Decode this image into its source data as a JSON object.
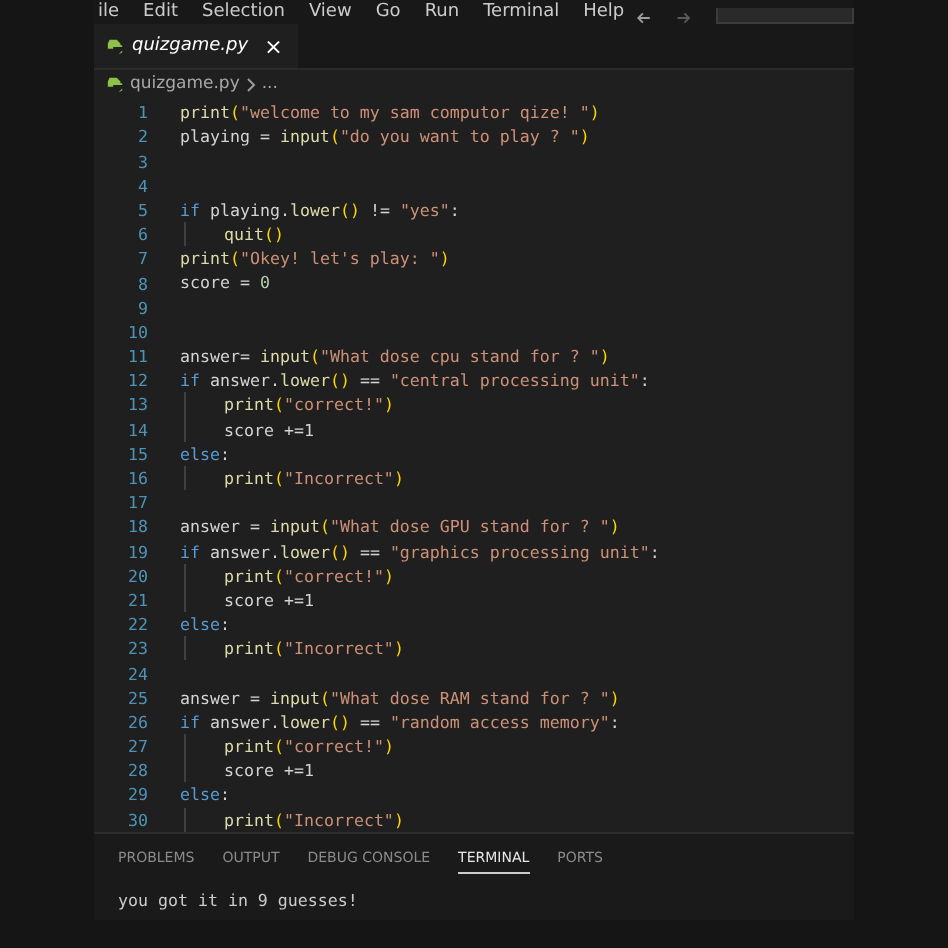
{
  "menu": [
    "ile",
    "Edit",
    "Selection",
    "View",
    "Go",
    "Run",
    "Terminal",
    "Help"
  ],
  "tab": {
    "label": "quizgame.py",
    "close": "×",
    "selected": true
  },
  "breadcrumb": {
    "file": "quizgame.py",
    "more": "..."
  },
  "code": [
    {
      "number": "1",
      "tokens": [
        {
          "kind": "func",
          "text": "print"
        },
        {
          "kind": "paren",
          "text": "("
        },
        {
          "kind": "string",
          "text": "\"welcome to my sam computor qize! \""
        },
        {
          "kind": "paren",
          "text": ")"
        }
      ]
    },
    {
      "number": "2",
      "tokens": [
        {
          "kind": "plain",
          "text": "playing = "
        },
        {
          "kind": "func",
          "text": "input"
        },
        {
          "kind": "paren",
          "text": "("
        },
        {
          "kind": "string",
          "text": "\"do you want to play ? \""
        },
        {
          "kind": "paren",
          "text": ")"
        }
      ]
    },
    {
      "number": "3"
    },
    {
      "number": "4"
    },
    {
      "number": "5",
      "tokens": [
        {
          "kind": "keyword",
          "text": "if"
        },
        {
          "kind": "plain",
          "text": " playing."
        },
        {
          "kind": "func",
          "text": "lower"
        },
        {
          "kind": "paren",
          "text": "()"
        },
        {
          "kind": "plain",
          "text": " != "
        },
        {
          "kind": "string",
          "text": "\"yes\""
        },
        {
          "kind": "plain",
          "text": ":"
        }
      ]
    },
    {
      "number": "6",
      "indented": true,
      "tokens": [
        {
          "kind": "func",
          "text": "quit"
        },
        {
          "kind": "paren",
          "text": "()"
        }
      ]
    },
    {
      "number": "7",
      "tokens": [
        {
          "kind": "func",
          "text": "print"
        },
        {
          "kind": "paren",
          "text": "("
        },
        {
          "kind": "string",
          "text": "\"Okey! let's play: \""
        },
        {
          "kind": "paren",
          "text": ")"
        }
      ]
    },
    {
      "number": "8",
      "tokens": [
        {
          "kind": "plain",
          "text": "score = "
        },
        {
          "kind": "number",
          "text": "0"
        }
      ]
    },
    {
      "number": "9"
    },
    {
      "number": "10"
    },
    {
      "number": "11",
      "tokens": [
        {
          "kind": "plain",
          "text": "answer= "
        },
        {
          "kind": "func",
          "text": "input"
        },
        {
          "kind": "paren",
          "text": "("
        },
        {
          "kind": "string",
          "text": "\"What dose cpu stand for ? \""
        },
        {
          "kind": "paren",
          "text": ")"
        }
      ]
    },
    {
      "number": "12",
      "tokens": [
        {
          "kind": "keyword",
          "text": "if"
        },
        {
          "kind": "plain",
          "text": " answer."
        },
        {
          "kind": "func",
          "text": "lower"
        },
        {
          "kind": "paren",
          "text": "()"
        },
        {
          "kind": "plain",
          "text": " == "
        },
        {
          "kind": "string",
          "text": "\"central processing unit\""
        },
        {
          "kind": "plain",
          "text": ":"
        }
      ]
    },
    {
      "number": "13",
      "indented": true,
      "tokens": [
        {
          "kind": "func",
          "text": "print"
        },
        {
          "kind": "paren",
          "text": "("
        },
        {
          "kind": "string",
          "text": "\"correct!\""
        },
        {
          "kind": "paren",
          "text": ")"
        }
      ]
    },
    {
      "number": "14",
      "indented": true,
      "tokens": [
        {
          "kind": "plain",
          "text": "score +=1"
        }
      ]
    },
    {
      "number": "15",
      "tokens": [
        {
          "kind": "keyword",
          "text": "else"
        },
        {
          "kind": "plain",
          "text": ":"
        }
      ]
    },
    {
      "number": "16",
      "indented": true,
      "tokens": [
        {
          "kind": "func",
          "text": "print"
        },
        {
          "kind": "paren",
          "text": "("
        },
        {
          "kind": "string",
          "text": "\"Incorrect\""
        },
        {
          "kind": "paren",
          "text": ")"
        }
      ]
    },
    {
      "number": "17"
    },
    {
      "number": "18",
      "tokens": [
        {
          "kind": "plain",
          "text": "answer = "
        },
        {
          "kind": "func",
          "text": "input"
        },
        {
          "kind": "paren",
          "text": "("
        },
        {
          "kind": "string",
          "text": "\"What dose GPU stand for ? \""
        },
        {
          "kind": "paren",
          "text": ")"
        }
      ]
    },
    {
      "number": "19",
      "tokens": [
        {
          "kind": "keyword",
          "text": "if"
        },
        {
          "kind": "plain",
          "text": " answer."
        },
        {
          "kind": "func",
          "text": "lower"
        },
        {
          "kind": "paren",
          "text": "()"
        },
        {
          "kind": "plain",
          "text": " == "
        },
        {
          "kind": "string",
          "text": "\"graphics processing unit\""
        },
        {
          "kind": "plain",
          "text": ":"
        }
      ]
    },
    {
      "number": "20",
      "indented": true,
      "tokens": [
        {
          "kind": "func",
          "text": "print"
        },
        {
          "kind": "paren",
          "text": "("
        },
        {
          "kind": "string",
          "text": "\"correct!\""
        },
        {
          "kind": "paren",
          "text": ")"
        }
      ]
    },
    {
      "number": "21",
      "indented": true,
      "tokens": [
        {
          "kind": "plain",
          "text": "score +=1"
        }
      ]
    },
    {
      "number": "22",
      "tokens": [
        {
          "kind": "keyword",
          "text": "else"
        },
        {
          "kind": "plain",
          "text": ":"
        }
      ]
    },
    {
      "number": "23",
      "indented": true,
      "tokens": [
        {
          "kind": "func",
          "text": "print"
        },
        {
          "kind": "paren",
          "text": "("
        },
        {
          "kind": "string",
          "text": "\"Incorrect\""
        },
        {
          "kind": "paren",
          "text": ")"
        }
      ]
    },
    {
      "number": "24"
    },
    {
      "number": "25",
      "tokens": [
        {
          "kind": "plain",
          "text": "answer = "
        },
        {
          "kind": "func",
          "text": "input"
        },
        {
          "kind": "paren",
          "text": "("
        },
        {
          "kind": "string",
          "text": "\"What dose RAM stand for ? \""
        },
        {
          "kind": "paren",
          "text": ")"
        }
      ]
    },
    {
      "number": "26",
      "tokens": [
        {
          "kind": "keyword",
          "text": "if"
        },
        {
          "kind": "plain",
          "text": " answer."
        },
        {
          "kind": "func",
          "text": "lower"
        },
        {
          "kind": "paren",
          "text": "()"
        },
        {
          "kind": "plain",
          "text": " == "
        },
        {
          "kind": "string",
          "text": "\"random access memory\""
        },
        {
          "kind": "plain",
          "text": ":"
        }
      ]
    },
    {
      "number": "27",
      "indented": true,
      "tokens": [
        {
          "kind": "func",
          "text": "print"
        },
        {
          "kind": "paren",
          "text": "("
        },
        {
          "kind": "string",
          "text": "\"correct!\""
        },
        {
          "kind": "paren",
          "text": ")"
        }
      ]
    },
    {
      "number": "28",
      "indented": true,
      "tokens": [
        {
          "kind": "plain",
          "text": "score +=1"
        }
      ]
    },
    {
      "number": "29",
      "tokens": [
        {
          "kind": "keyword",
          "text": "else"
        },
        {
          "kind": "plain",
          "text": ":"
        }
      ]
    },
    {
      "number": "30",
      "indented": true,
      "tokens": [
        {
          "kind": "func",
          "text": "print"
        },
        {
          "kind": "paren",
          "text": "("
        },
        {
          "kind": "string",
          "text": "\"Incorrect\""
        },
        {
          "kind": "paren",
          "text": ")"
        }
      ]
    }
  ],
  "panel_tabs": [
    {
      "label": "PROBLEMS",
      "selected": false
    },
    {
      "label": "OUTPUT",
      "selected": false
    },
    {
      "label": "DEBUG CONSOLE",
      "selected": false
    },
    {
      "label": "TERMINAL",
      "selected": true
    },
    {
      "label": "PORTS",
      "selected": false
    }
  ],
  "terminal": [
    "you got it in 9 guesses!"
  ]
}
